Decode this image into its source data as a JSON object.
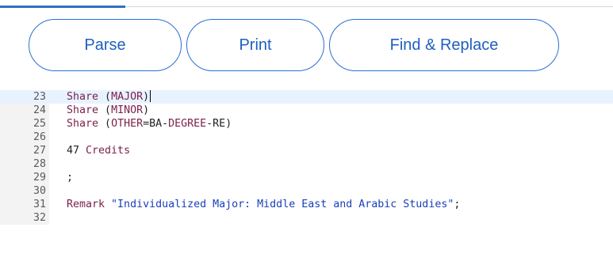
{
  "toolbar": {
    "parse_label": "Parse",
    "print_label": "Print",
    "find_replace_label": "Find & Replace"
  },
  "editor": {
    "active_line": 23,
    "lines": [
      {
        "num": "23",
        "tokens": [
          {
            "t": "Share ",
            "c": "kw"
          },
          {
            "t": "(",
            "c": "plain"
          },
          {
            "t": "MAJOR",
            "c": "kw"
          },
          {
            "t": ")",
            "c": "plain"
          }
        ]
      },
      {
        "num": "24",
        "tokens": [
          {
            "t": "Share ",
            "c": "kw"
          },
          {
            "t": "(",
            "c": "plain"
          },
          {
            "t": "MINOR",
            "c": "kw"
          },
          {
            "t": ")",
            "c": "plain"
          }
        ]
      },
      {
        "num": "25",
        "tokens": [
          {
            "t": "Share ",
            "c": "kw"
          },
          {
            "t": "(",
            "c": "plain"
          },
          {
            "t": "OTHER",
            "c": "kw"
          },
          {
            "t": "=BA-",
            "c": "plain"
          },
          {
            "t": "DEGREE",
            "c": "kw"
          },
          {
            "t": "-RE)",
            "c": "plain"
          }
        ]
      },
      {
        "num": "26",
        "tokens": []
      },
      {
        "num": "27",
        "tokens": [
          {
            "t": "47 ",
            "c": "plain"
          },
          {
            "t": "Credits",
            "c": "kw"
          }
        ]
      },
      {
        "num": "28",
        "tokens": []
      },
      {
        "num": "29",
        "tokens": [
          {
            "t": ";",
            "c": "plain"
          }
        ]
      },
      {
        "num": "30",
        "tokens": []
      },
      {
        "num": "31",
        "tokens": [
          {
            "t": "Remark ",
            "c": "kw"
          },
          {
            "t": "\"Individualized Major: Middle East and Arabic Studies\"",
            "c": "str"
          },
          {
            "t": ";",
            "c": "plain"
          }
        ]
      },
      {
        "num": "32",
        "tokens": []
      }
    ]
  }
}
